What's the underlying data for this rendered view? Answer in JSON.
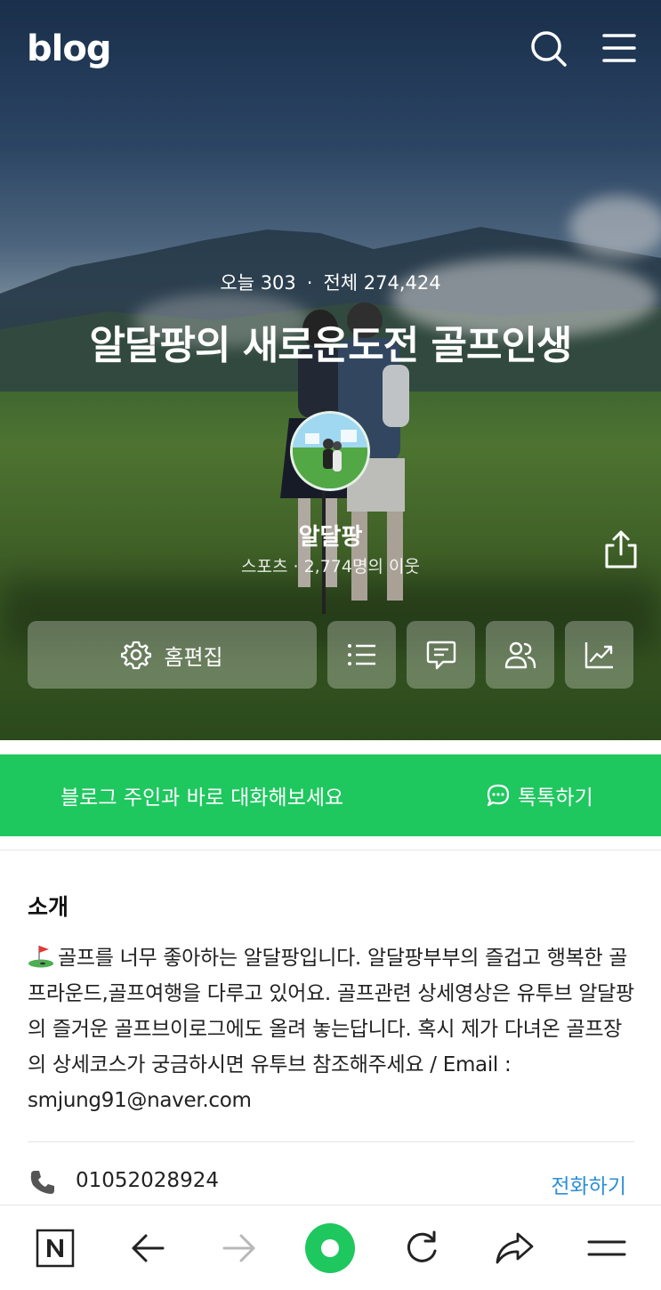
{
  "header": {
    "logo": "blog",
    "icons": [
      "search-icon",
      "menu-icon"
    ]
  },
  "stats": {
    "today_label": "오늘 303",
    "separator": "·",
    "total_label": "전체 274,424"
  },
  "blog": {
    "title": "알달팡의 새로운도전 골프인생",
    "nickname": "알달팡",
    "subtitle": "스포츠 · 2,774명의 이웃"
  },
  "actions": {
    "home_edit": "홈편집",
    "icons": [
      "list-icon",
      "comment-icon",
      "neighbors-icon",
      "stats-icon"
    ]
  },
  "talk": {
    "message": "블로그 주인과 바로 대화해보세요",
    "action": "톡톡하기"
  },
  "intro": {
    "title": "소개",
    "body": "골프를 너무 좋아하는 알달팡입니다. 알달팡부부의 즐겁고 행복한 골프라운드,골프여행을 다루고 있어요. 골프관련 상세영상은 유투브 알달팡의 즐거운 골프브이로그에도 올려 놓는답니다. 혹시 제가 다녀온 골프장의 상세코스가 궁금하시면 유투브 참조해주세요 / Email : smjung91@naver.com"
  },
  "contact": {
    "phone": "01052028924",
    "call_label": "전화하기"
  },
  "navbar": {
    "icons": [
      "naver-n-icon",
      "back-arrow-icon",
      "forward-arrow-icon",
      "green-home-icon",
      "refresh-icon",
      "share-arrow-icon",
      "menu-lines-icon"
    ]
  },
  "colors": {
    "green": "#1fc75f",
    "link_blue": "#2d8fd5"
  }
}
